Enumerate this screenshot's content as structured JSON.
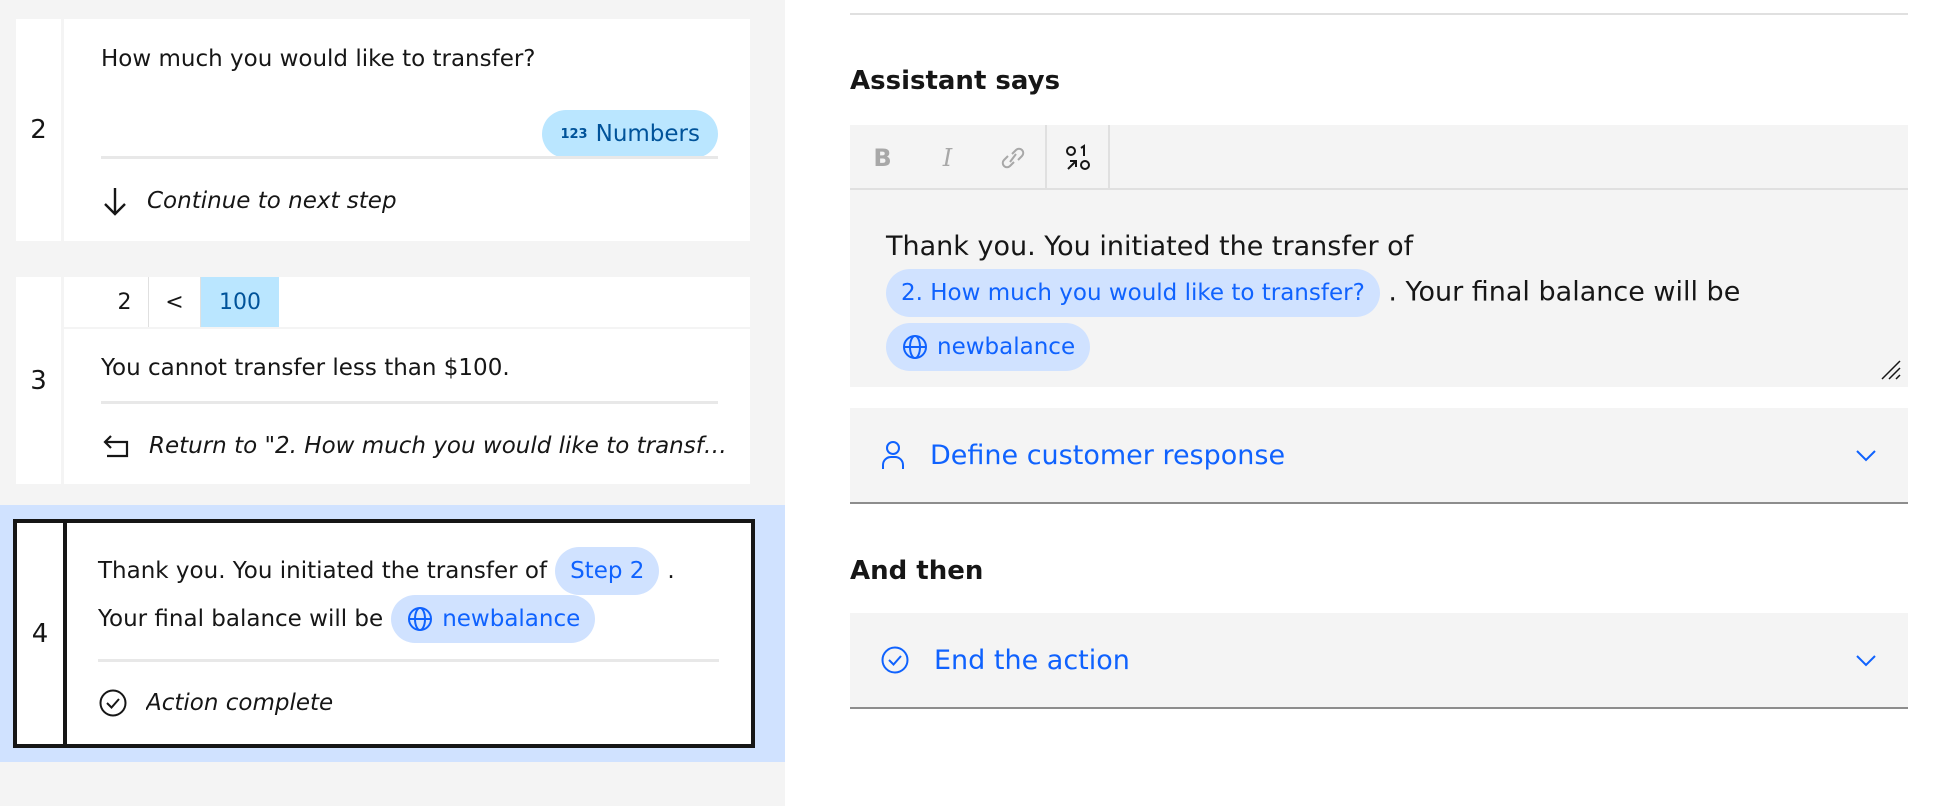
{
  "steps": {
    "step2": {
      "number": "2",
      "text": "How much you would like to transfer?",
      "response_type": "Numbers",
      "response_icon_text": "123",
      "footer": "Continue to next step"
    },
    "step3": {
      "number": "3",
      "condition": {
        "step": "2",
        "operator": "<",
        "value": "100"
      },
      "text": "You cannot transfer less than $100.",
      "footer": "Return to \"2. How much you would like to transfer?\""
    },
    "step4": {
      "number": "4",
      "text_before": "Thank you. You initiated the transfer of",
      "step_chip": "Step 2",
      "text_after": ".",
      "line2": "Your final balance will be",
      "variable_chip": "newbalance",
      "footer": "Action complete"
    }
  },
  "editor": {
    "heading": "Assistant says",
    "toolbar": {
      "bold": "B",
      "italic": "I"
    },
    "text_before": "Thank you. You initiated the transfer of",
    "step_chip": "2. How much you would like to transfer?",
    "text_after": ". Your final balance will be",
    "variable_chip": "newbalance"
  },
  "customer_response": {
    "label": "Define customer response"
  },
  "and_then": {
    "heading": "And then",
    "label": "End the action"
  },
  "colors": {
    "accent": "#0f62fe",
    "chip_blue": "#d0e2ff",
    "chip_cyan": "#bae6ff",
    "selected_bg": "#d0e2ff"
  }
}
